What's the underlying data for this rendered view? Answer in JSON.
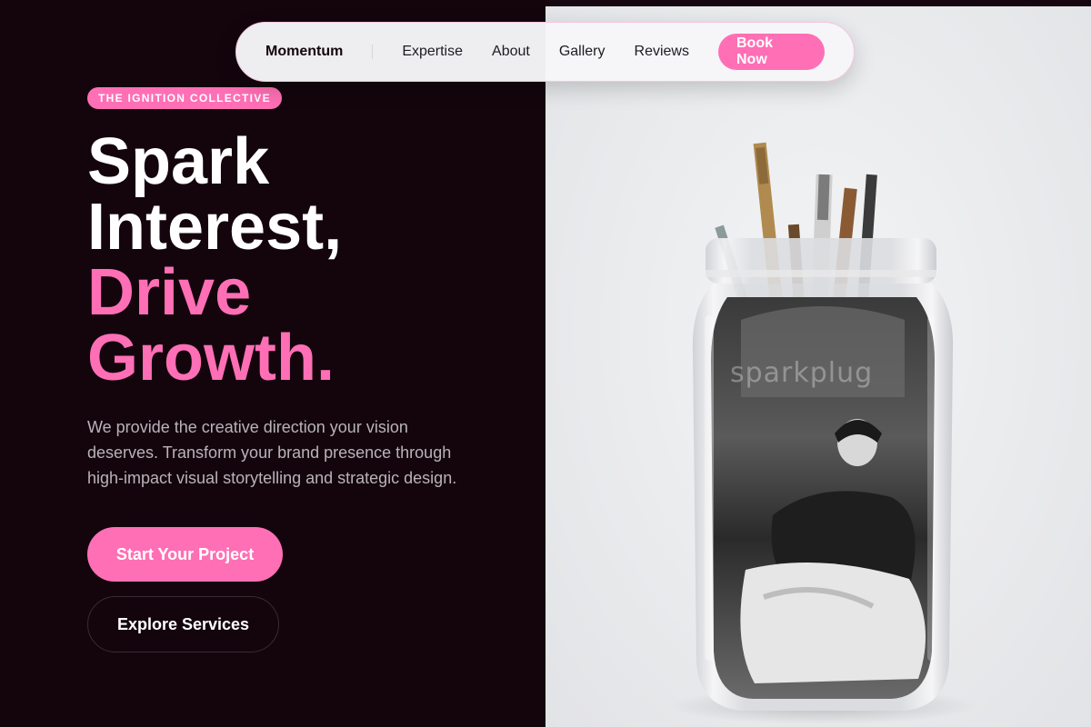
{
  "nav": {
    "brand": "Momentum",
    "links": [
      "Expertise",
      "About",
      "Gallery",
      "Reviews"
    ],
    "cta": "Book Now"
  },
  "hero": {
    "badge": "THE IGNITION COLLECTIVE",
    "headline_lines": [
      "Spark",
      "Interest,",
      "Drive",
      "Growth."
    ],
    "description": "We provide the creative direction your vision deserves. Transform your brand presence through high-impact visual storytelling and strategic design.",
    "primary_cta": "Start Your Project",
    "secondary_cta": "Explore Services"
  },
  "image": {
    "watermark": "sparkplug"
  },
  "colors": {
    "accent": "#ff6fb5",
    "background": "#14050d",
    "image_bg": "#e9eaec"
  }
}
